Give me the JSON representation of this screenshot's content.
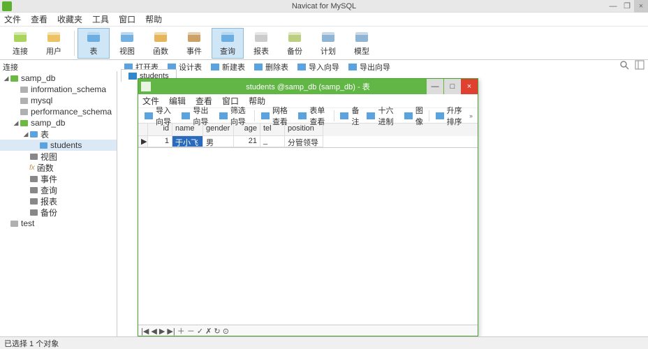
{
  "app": {
    "title": "Navicat for MySQL",
    "win_min": "—",
    "win_max": "❐",
    "win_close": "×"
  },
  "menu": [
    "文件",
    "查看",
    "收藏夹",
    "工具",
    "窗口",
    "帮助"
  ],
  "ribbon": [
    {
      "label": "连接",
      "icon": "plug-icon",
      "color": "#9bcd3e"
    },
    {
      "label": "用户",
      "icon": "user-icon",
      "color": "#e8b84a"
    },
    {
      "sep": true
    },
    {
      "label": "表",
      "icon": "table-icon",
      "color": "#5aa3de",
      "selected": true
    },
    {
      "label": "视图",
      "icon": "view-icon",
      "color": "#5aa3de"
    },
    {
      "label": "函数",
      "icon": "function-icon",
      "color": "#e2a83e"
    },
    {
      "label": "事件",
      "icon": "event-icon",
      "color": "#c48f4a"
    },
    {
      "label": "查询",
      "icon": "query-icon",
      "color": "#5aa3de",
      "selected": true
    },
    {
      "label": "报表",
      "icon": "report-icon",
      "color": "#c3c3c3"
    },
    {
      "label": "备份",
      "icon": "backup-icon",
      "color": "#b0c66a"
    },
    {
      "label": "计划",
      "icon": "schedule-icon",
      "color": "#7da7cb"
    },
    {
      "label": "模型",
      "icon": "model-icon",
      "color": "#7da7cb"
    }
  ],
  "sublabel": "连接",
  "subtoolbar": [
    {
      "label": "打开表",
      "icon": "open-icon"
    },
    {
      "label": "设计表",
      "icon": "design-icon"
    },
    {
      "label": "新建表",
      "icon": "new-icon"
    },
    {
      "label": "删除表",
      "icon": "delete-icon"
    },
    {
      "label": "导入向导",
      "icon": "import-icon"
    },
    {
      "label": "导出向导",
      "icon": "export-icon"
    }
  ],
  "tree": [
    {
      "indent": 0,
      "tw": "◢",
      "icon": "conn-icon",
      "color": "#6cb844",
      "label": "samp_db"
    },
    {
      "indent": 1,
      "tw": "",
      "icon": "db-icon",
      "color": "#b0b0b0",
      "label": "information_schema"
    },
    {
      "indent": 1,
      "tw": "",
      "icon": "db-icon",
      "color": "#b0b0b0",
      "label": "mysql"
    },
    {
      "indent": 1,
      "tw": "",
      "icon": "db-icon",
      "color": "#b0b0b0",
      "label": "performance_schema"
    },
    {
      "indent": 1,
      "tw": "◢",
      "icon": "db-icon",
      "color": "#6cb844",
      "label": "samp_db"
    },
    {
      "indent": 2,
      "tw": "◢",
      "icon": "tables-icon",
      "color": "#5aa3de",
      "label": "表"
    },
    {
      "indent": 3,
      "tw": "",
      "icon": "table-icon",
      "color": "#5aa3de",
      "label": "students",
      "selected": true
    },
    {
      "indent": 2,
      "tw": "",
      "icon": "view-sm-icon",
      "color": "#888",
      "label": "视图"
    },
    {
      "indent": 2,
      "tw": "",
      "icon": "fn-sm-icon",
      "color": "#c48f4a",
      "label": "函数",
      "prefix": "fx"
    },
    {
      "indent": 2,
      "tw": "",
      "icon": "event-sm-icon",
      "color": "#888",
      "label": "事件"
    },
    {
      "indent": 2,
      "tw": "",
      "icon": "query-sm-icon",
      "color": "#888",
      "label": "查询"
    },
    {
      "indent": 2,
      "tw": "",
      "icon": "report-sm-icon",
      "color": "#888",
      "label": "报表"
    },
    {
      "indent": 2,
      "tw": "",
      "icon": "backup-sm-icon",
      "color": "#888",
      "label": "备份"
    },
    {
      "indent": 0,
      "tw": "",
      "icon": "conn-off-icon",
      "color": "#b0b0b0",
      "label": "test"
    }
  ],
  "main_tab": "students",
  "inner": {
    "title": "students @samp_db (samp_db) - 表",
    "menu": [
      "文件",
      "编辑",
      "查看",
      "窗口",
      "帮助"
    ],
    "toolbar": [
      {
        "label": "导入向导",
        "icon": "import-icon"
      },
      {
        "label": "导出向导",
        "icon": "export-icon"
      },
      {
        "label": "筛选向导",
        "icon": "filter-icon"
      },
      {
        "sep": true
      },
      {
        "label": "网格查看",
        "icon": "grid-icon"
      },
      {
        "label": "表单查看",
        "icon": "form-icon"
      },
      {
        "sep": true
      },
      {
        "label": "备注",
        "icon": "memo-icon"
      },
      {
        "label": "十六进制",
        "icon": "hex-icon"
      },
      {
        "label": "图像",
        "icon": "image-icon"
      },
      {
        "sep": true
      },
      {
        "label": "升序排序",
        "icon": "sort-asc-icon"
      }
    ],
    "columns": [
      "",
      "id",
      "name",
      "gender",
      "age",
      "tel",
      "position"
    ],
    "rows": [
      {
        "marker": "▶",
        "id": "1",
        "name": "于小飞",
        "gender": "男",
        "age": "21",
        "tel": "_",
        "position": "分管领导",
        "sel_col": "name"
      }
    ],
    "nav": "|◀  ◀  ▶  ▶|  ＋ － ✓ ✗   ↻  ⊙"
  },
  "status": "已选择 1 个对象"
}
